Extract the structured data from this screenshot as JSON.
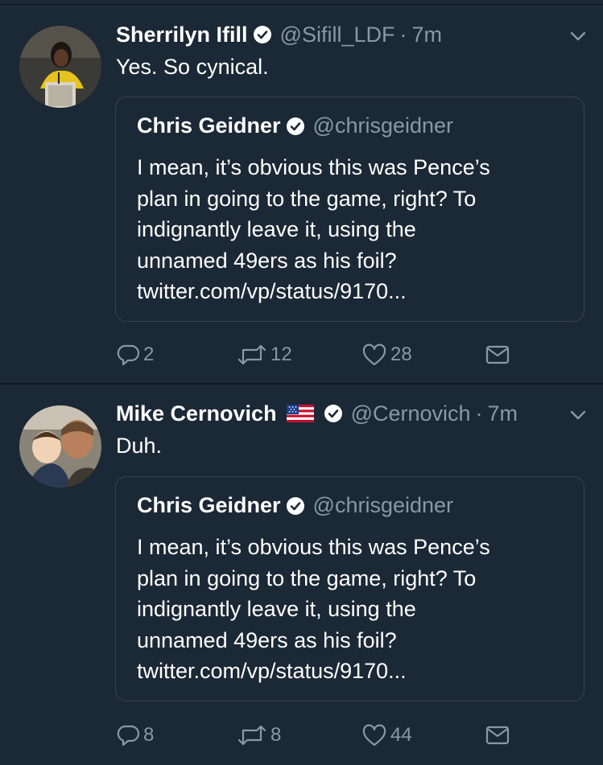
{
  "colors": {
    "background": "#1b2836",
    "text_primary": "#ffffff",
    "text_secondary": "#8899a6",
    "border": "#38444d",
    "verified_badge": "#ffffff"
  },
  "tweets": [
    {
      "author": {
        "name": "Sherrilyn Ifill",
        "handle": "@Sifill_LDF",
        "verified": true,
        "avatar_icon": "avatar-photo"
      },
      "time": "7m",
      "text": "Yes. So cynical.",
      "quote": {
        "name": "Chris Geidner",
        "handle": "@chrisgeidner",
        "verified": true,
        "text": "I mean, it’s obvious this was Pence’s\nplan in going to the game, right? To\nindignantly leave it, using the\nunnamed 49ers as his foil?\ntwitter.com/vp/status/9170..."
      },
      "actions": {
        "replies": "2",
        "retweets": "12",
        "likes": "28"
      }
    },
    {
      "author": {
        "name": "Mike Cernovich",
        "flag": "🇺🇸",
        "handle": "@Cernovich",
        "verified": true,
        "avatar_icon": "avatar-photo"
      },
      "time": "7m",
      "text": "Duh.",
      "quote": {
        "name": "Chris Geidner",
        "handle": "@chrisgeidner",
        "verified": true,
        "text": "I mean, it’s obvious this was Pence’s\nplan in going to the game, right? To\nindignantly leave it, using the\nunnamed 49ers as his foil?\ntwitter.com/vp/status/9170..."
      },
      "actions": {
        "replies": "8",
        "retweets": "8",
        "likes": "44"
      }
    }
  ],
  "separator": "·",
  "icons": [
    "verified-badge-icon",
    "chevron-down-icon",
    "reply-icon",
    "retweet-icon",
    "like-icon",
    "direct-message-icon",
    "us-flag-icon"
  ]
}
